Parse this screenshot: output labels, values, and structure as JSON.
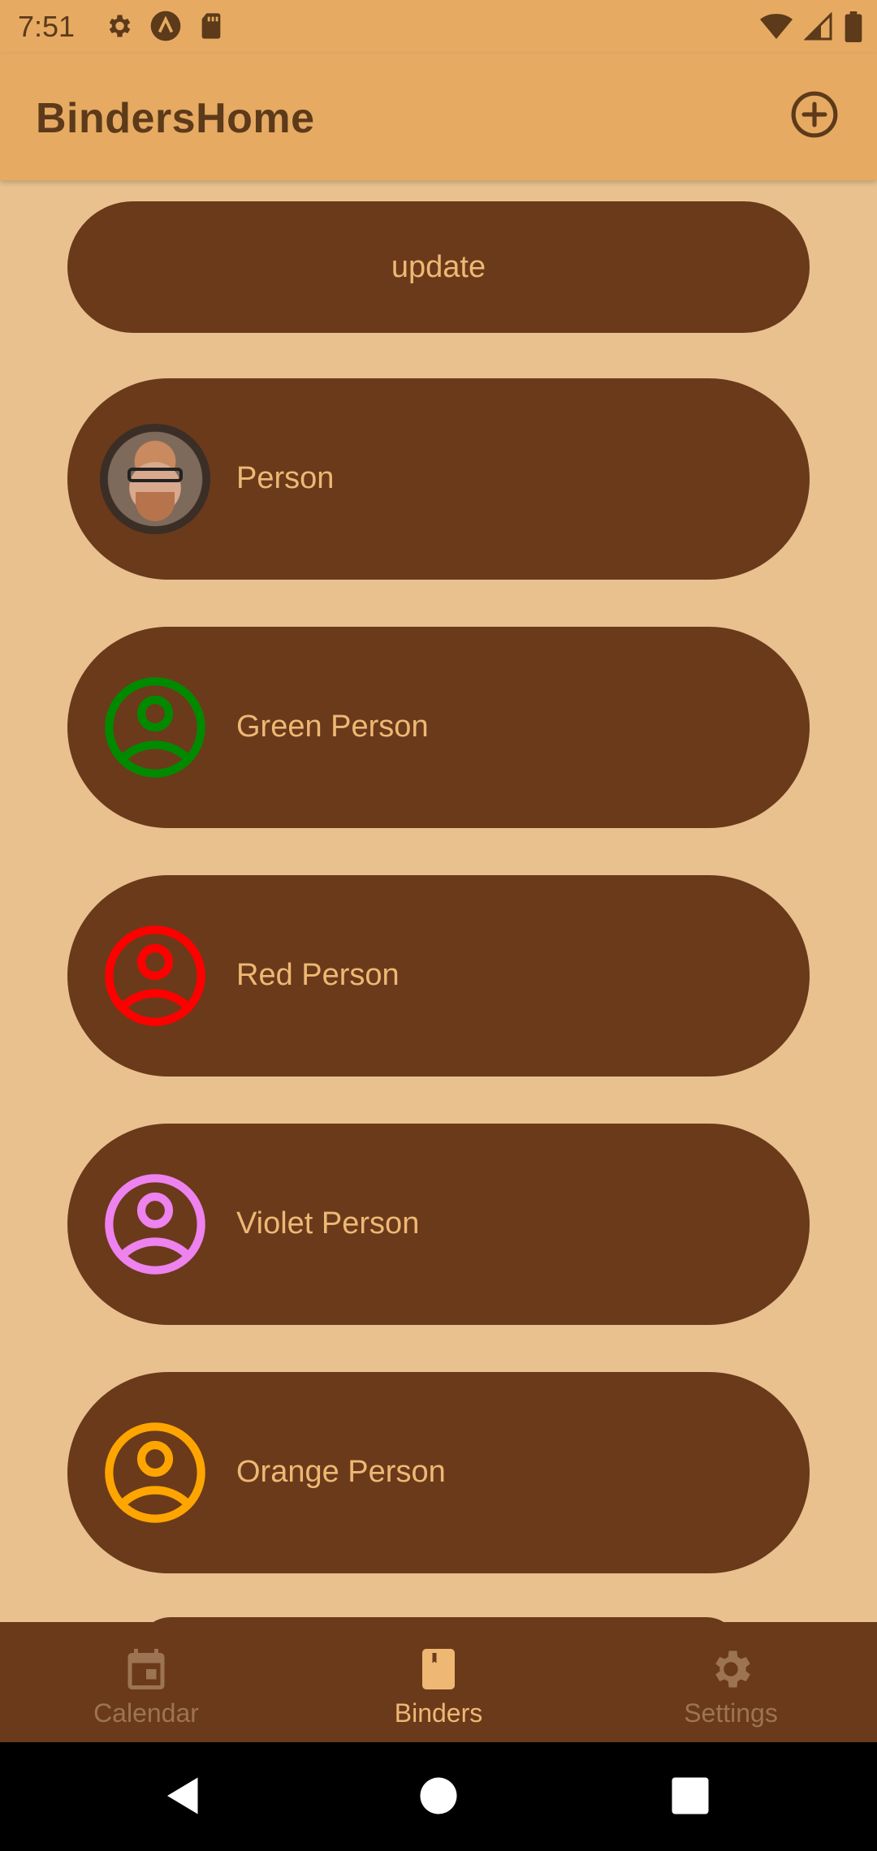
{
  "status_bar": {
    "time": "7:51",
    "left_icons": [
      "settings-gear-icon",
      "app-notification-icon",
      "sd-card-icon"
    ],
    "right_icons": [
      "wifi-icon",
      "cell-signal-icon",
      "battery-icon"
    ]
  },
  "app_bar": {
    "title": "BindersHome",
    "action_icon": "add-circle-icon"
  },
  "update_button": {
    "label": "update"
  },
  "people": [
    {
      "name": "Person",
      "avatar": "photo"
    },
    {
      "name": "Green Person",
      "avatar": "person-outline-icon",
      "color": "#008A00"
    },
    {
      "name": "Red Person",
      "avatar": "person-outline-icon",
      "color": "#FF0000"
    },
    {
      "name": "Violet Person",
      "avatar": "person-outline-icon",
      "color": "#EE82EE"
    },
    {
      "name": "Orange Person",
      "avatar": "person-outline-icon",
      "color": "#FFA500"
    }
  ],
  "bottom_nav": {
    "items": [
      {
        "label": "Calendar",
        "icon": "calendar-icon",
        "active": false
      },
      {
        "label": "Binders",
        "icon": "binder-icon",
        "active": true
      },
      {
        "label": "Settings",
        "icon": "settings-gear-icon",
        "active": false
      }
    ]
  },
  "colors": {
    "app_bar": "#E6AA62",
    "background": "#E9C18E",
    "pill": "#6A3A1B",
    "pill_text": "#EEB874",
    "nav_inactive": "#9C7454"
  }
}
